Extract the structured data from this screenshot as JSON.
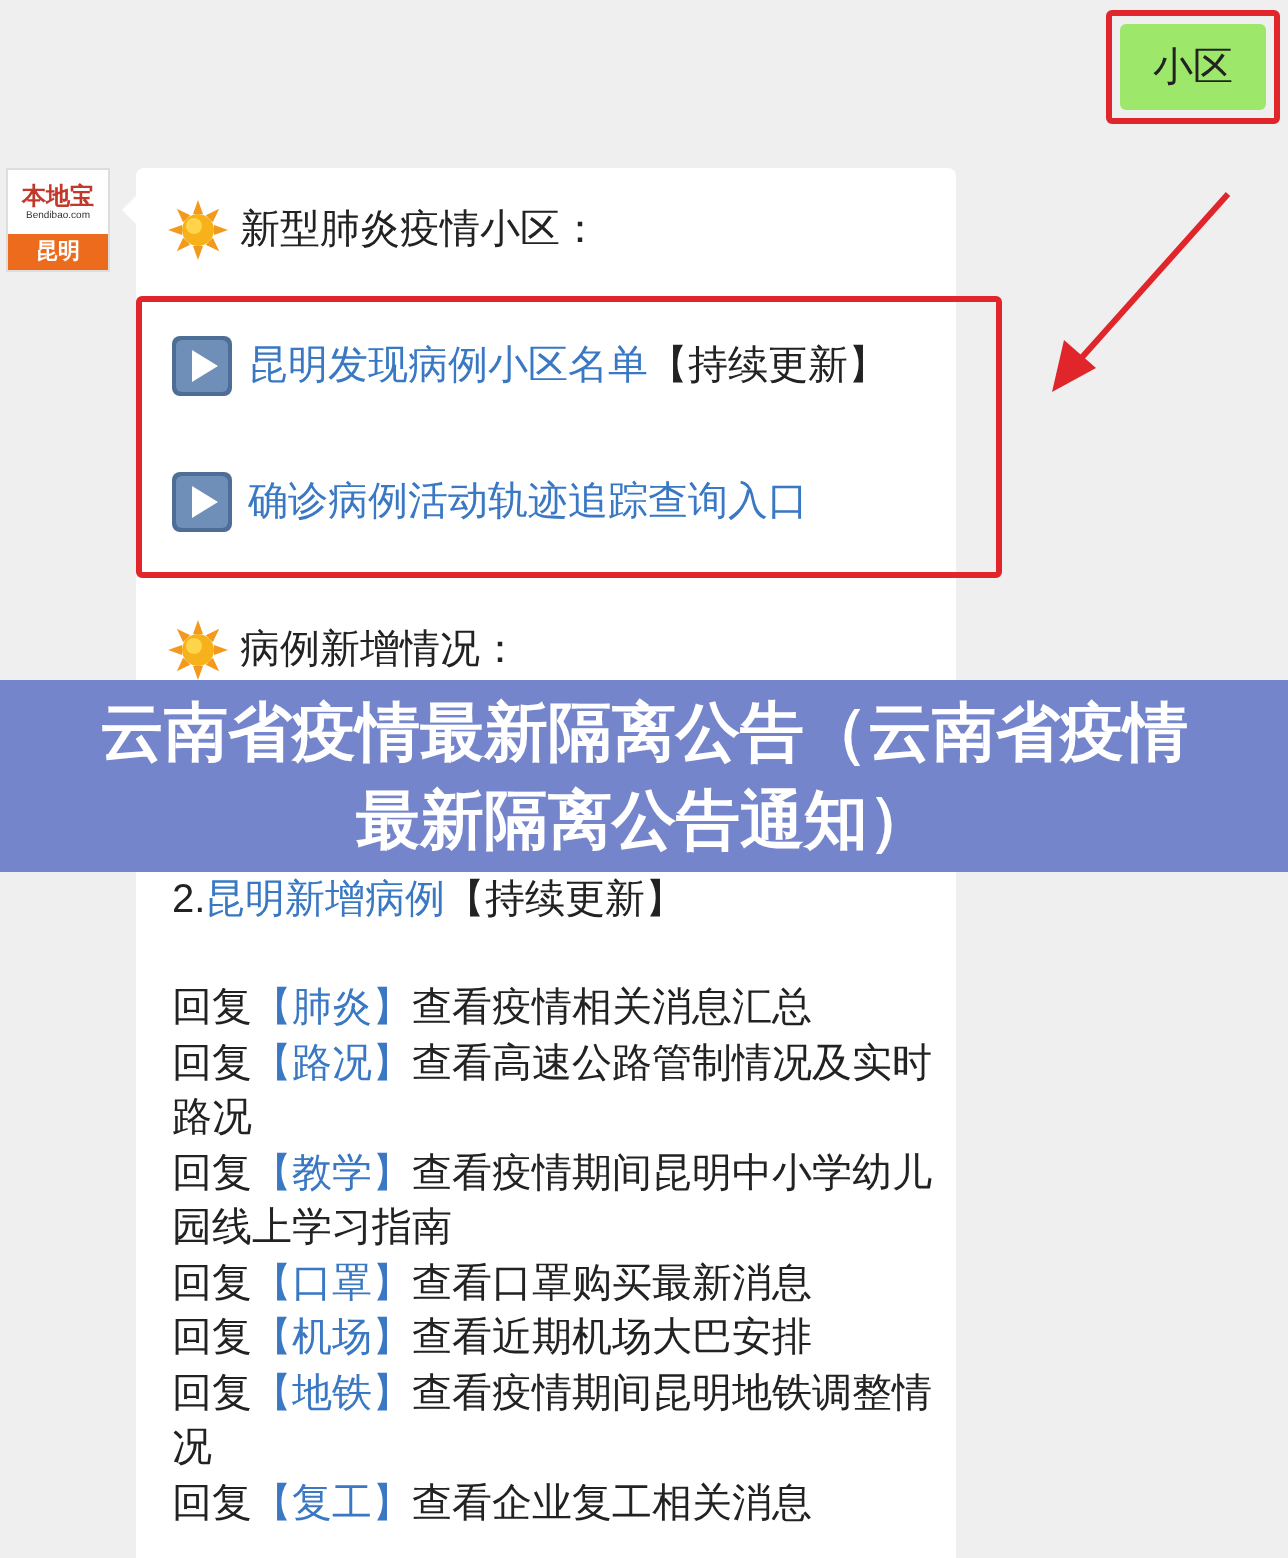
{
  "sent_message": {
    "text": "小区"
  },
  "sender_avatar": {
    "brand": "本地宝",
    "domain": "Bendibao.com",
    "city": "昆明"
  },
  "message": {
    "heading_1": "新型肺炎疫情小区：",
    "entry_links": [
      {
        "text": "昆明发现病例小区名单",
        "note": "【持续更新】"
      },
      {
        "text": "确诊病例活动轨迹追踪查询入口"
      }
    ],
    "heading_2": "病例新增情况：",
    "case_updates": [
      {
        "number": "2.",
        "link": "昆明新增病例",
        "note": "【持续更新】"
      }
    ],
    "replies": [
      {
        "prefix": "回复",
        "keyword": "【肺炎】",
        "description": "查看疫情相关消息汇总"
      },
      {
        "prefix": "回复",
        "keyword": "【路况】",
        "description": "查看高速公路管制情况及实时路况"
      },
      {
        "prefix": "回复",
        "keyword": "【教学】",
        "description": "查看疫情期间昆明中小学幼儿园线上学习指南"
      },
      {
        "prefix": "回复",
        "keyword": "【口罩】",
        "description": "查看口罩购买最新消息"
      },
      {
        "prefix": "回复",
        "keyword": "【机场】",
        "description": "查看近期机场大巴安排"
      },
      {
        "prefix": "回复",
        "keyword": "【地铁】",
        "description": "查看疫情期间昆明地铁调整情况"
      },
      {
        "prefix": "回复",
        "keyword": "【复工】",
        "description": "查看企业复工相关消息"
      }
    ]
  },
  "banner": {
    "title": "云南省疫情最新隔离公告（云南省疫情最新隔离公告通知）"
  }
}
